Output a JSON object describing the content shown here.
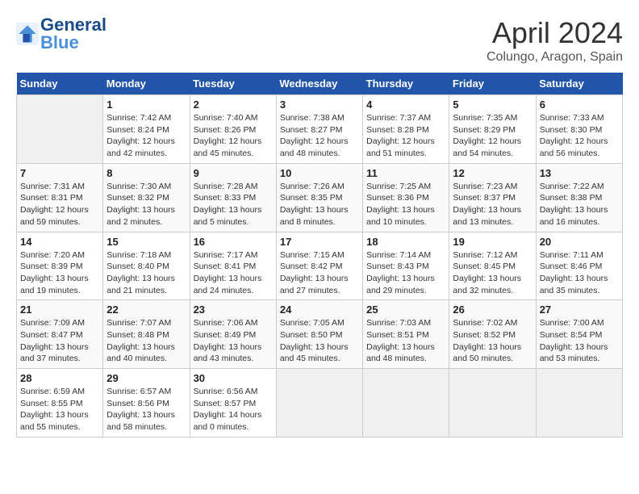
{
  "header": {
    "logo_line1": "General",
    "logo_line2": "Blue",
    "title": "April 2024",
    "subtitle": "Colungo, Aragon, Spain"
  },
  "days_of_week": [
    "Sunday",
    "Monday",
    "Tuesday",
    "Wednesday",
    "Thursday",
    "Friday",
    "Saturday"
  ],
  "weeks": [
    [
      {
        "day": "",
        "info": ""
      },
      {
        "day": "1",
        "info": "Sunrise: 7:42 AM\nSunset: 8:24 PM\nDaylight: 12 hours\nand 42 minutes."
      },
      {
        "day": "2",
        "info": "Sunrise: 7:40 AM\nSunset: 8:26 PM\nDaylight: 12 hours\nand 45 minutes."
      },
      {
        "day": "3",
        "info": "Sunrise: 7:38 AM\nSunset: 8:27 PM\nDaylight: 12 hours\nand 48 minutes."
      },
      {
        "day": "4",
        "info": "Sunrise: 7:37 AM\nSunset: 8:28 PM\nDaylight: 12 hours\nand 51 minutes."
      },
      {
        "day": "5",
        "info": "Sunrise: 7:35 AM\nSunset: 8:29 PM\nDaylight: 12 hours\nand 54 minutes."
      },
      {
        "day": "6",
        "info": "Sunrise: 7:33 AM\nSunset: 8:30 PM\nDaylight: 12 hours\nand 56 minutes."
      }
    ],
    [
      {
        "day": "7",
        "info": "Sunrise: 7:31 AM\nSunset: 8:31 PM\nDaylight: 12 hours\nand 59 minutes."
      },
      {
        "day": "8",
        "info": "Sunrise: 7:30 AM\nSunset: 8:32 PM\nDaylight: 13 hours\nand 2 minutes."
      },
      {
        "day": "9",
        "info": "Sunrise: 7:28 AM\nSunset: 8:33 PM\nDaylight: 13 hours\nand 5 minutes."
      },
      {
        "day": "10",
        "info": "Sunrise: 7:26 AM\nSunset: 8:35 PM\nDaylight: 13 hours\nand 8 minutes."
      },
      {
        "day": "11",
        "info": "Sunrise: 7:25 AM\nSunset: 8:36 PM\nDaylight: 13 hours\nand 10 minutes."
      },
      {
        "day": "12",
        "info": "Sunrise: 7:23 AM\nSunset: 8:37 PM\nDaylight: 13 hours\nand 13 minutes."
      },
      {
        "day": "13",
        "info": "Sunrise: 7:22 AM\nSunset: 8:38 PM\nDaylight: 13 hours\nand 16 minutes."
      }
    ],
    [
      {
        "day": "14",
        "info": "Sunrise: 7:20 AM\nSunset: 8:39 PM\nDaylight: 13 hours\nand 19 minutes."
      },
      {
        "day": "15",
        "info": "Sunrise: 7:18 AM\nSunset: 8:40 PM\nDaylight: 13 hours\nand 21 minutes."
      },
      {
        "day": "16",
        "info": "Sunrise: 7:17 AM\nSunset: 8:41 PM\nDaylight: 13 hours\nand 24 minutes."
      },
      {
        "day": "17",
        "info": "Sunrise: 7:15 AM\nSunset: 8:42 PM\nDaylight: 13 hours\nand 27 minutes."
      },
      {
        "day": "18",
        "info": "Sunrise: 7:14 AM\nSunset: 8:43 PM\nDaylight: 13 hours\nand 29 minutes."
      },
      {
        "day": "19",
        "info": "Sunrise: 7:12 AM\nSunset: 8:45 PM\nDaylight: 13 hours\nand 32 minutes."
      },
      {
        "day": "20",
        "info": "Sunrise: 7:11 AM\nSunset: 8:46 PM\nDaylight: 13 hours\nand 35 minutes."
      }
    ],
    [
      {
        "day": "21",
        "info": "Sunrise: 7:09 AM\nSunset: 8:47 PM\nDaylight: 13 hours\nand 37 minutes."
      },
      {
        "day": "22",
        "info": "Sunrise: 7:07 AM\nSunset: 8:48 PM\nDaylight: 13 hours\nand 40 minutes."
      },
      {
        "day": "23",
        "info": "Sunrise: 7:06 AM\nSunset: 8:49 PM\nDaylight: 13 hours\nand 43 minutes."
      },
      {
        "day": "24",
        "info": "Sunrise: 7:05 AM\nSunset: 8:50 PM\nDaylight: 13 hours\nand 45 minutes."
      },
      {
        "day": "25",
        "info": "Sunrise: 7:03 AM\nSunset: 8:51 PM\nDaylight: 13 hours\nand 48 minutes."
      },
      {
        "day": "26",
        "info": "Sunrise: 7:02 AM\nSunset: 8:52 PM\nDaylight: 13 hours\nand 50 minutes."
      },
      {
        "day": "27",
        "info": "Sunrise: 7:00 AM\nSunset: 8:54 PM\nDaylight: 13 hours\nand 53 minutes."
      }
    ],
    [
      {
        "day": "28",
        "info": "Sunrise: 6:59 AM\nSunset: 8:55 PM\nDaylight: 13 hours\nand 55 minutes."
      },
      {
        "day": "29",
        "info": "Sunrise: 6:57 AM\nSunset: 8:56 PM\nDaylight: 13 hours\nand 58 minutes."
      },
      {
        "day": "30",
        "info": "Sunrise: 6:56 AM\nSunset: 8:57 PM\nDaylight: 14 hours\nand 0 minutes."
      },
      {
        "day": "",
        "info": ""
      },
      {
        "day": "",
        "info": ""
      },
      {
        "day": "",
        "info": ""
      },
      {
        "day": "",
        "info": ""
      }
    ]
  ]
}
